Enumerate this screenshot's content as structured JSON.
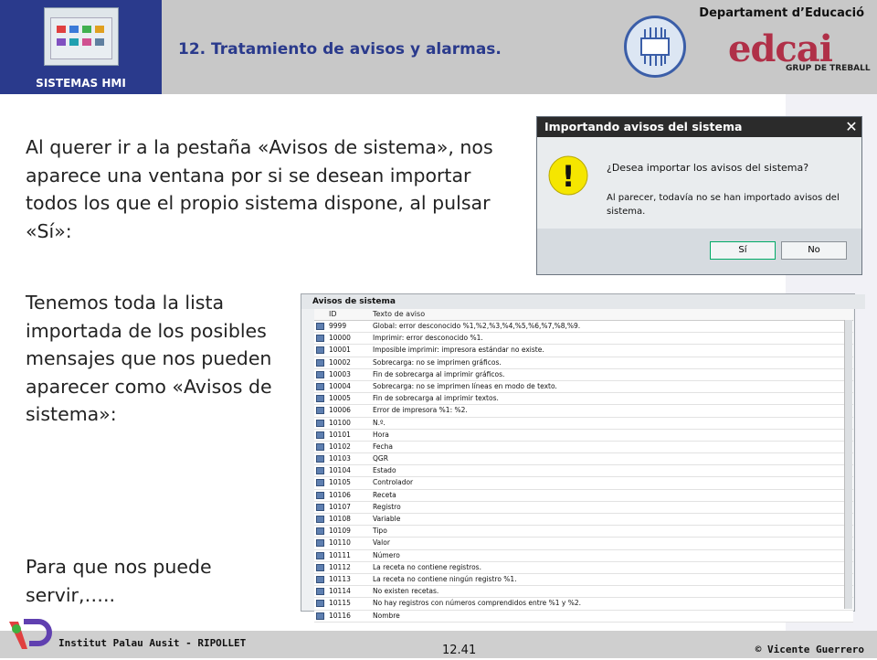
{
  "header": {
    "logo_label": "SISTEMAS HMI",
    "title": "12. Tratamiento de avisos y alarmas.",
    "department": "Departament d’Educació",
    "brand": "edcai",
    "brand_sub": "GRUP DE TREBALL",
    "colors": {
      "band": "#2a3a8c",
      "brand": "#b03048"
    }
  },
  "content": {
    "paragraph1": "Al querer ir a la pestaña «Avisos de sistema», nos aparece una ventana por si se desean importar todos los que el propio sistema dispone, al pulsar «Sí»:",
    "paragraph2": "Tenemos toda la lista importada de los posibles mensajes que nos pueden aparecer como «Avisos de sistema»:",
    "paragraph3": "Para que nos puede servir,….."
  },
  "dialog": {
    "title": "Importando avisos del sistema",
    "close_icon": "close-icon",
    "warning_icon": "warning-icon",
    "warning_glyph": "!",
    "question": "¿Desea importar los avisos del sistema?",
    "message": "Al parecer, todavía no se han importado avisos del sistema.",
    "yes_label": "Sí",
    "no_label": "No"
  },
  "table": {
    "title": "Avisos de sistema",
    "columns": [
      "ID",
      "Texto de aviso"
    ],
    "rows": [
      {
        "id": "9999",
        "text": "Global: error desconocido %1,%2,%3,%4,%5,%6,%7,%8,%9."
      },
      {
        "id": "10000",
        "text": "Imprimir: error desconocido %1."
      },
      {
        "id": "10001",
        "text": "Imposible imprimir: impresora estándar no existe."
      },
      {
        "id": "10002",
        "text": "Sobrecarga: no se imprimen gráficos."
      },
      {
        "id": "10003",
        "text": "Fin de sobrecarga al imprimir gráficos."
      },
      {
        "id": "10004",
        "text": "Sobrecarga: no se imprimen líneas en modo de texto."
      },
      {
        "id": "10005",
        "text": "Fin de sobrecarga al imprimir textos."
      },
      {
        "id": "10006",
        "text": "Error de impresora %1: %2."
      },
      {
        "id": "10100",
        "text": "N.º."
      },
      {
        "id": "10101",
        "text": "Hora"
      },
      {
        "id": "10102",
        "text": "Fecha"
      },
      {
        "id": "10103",
        "text": "QGR"
      },
      {
        "id": "10104",
        "text": "Estado"
      },
      {
        "id": "10105",
        "text": "Controlador"
      },
      {
        "id": "10106",
        "text": "Receta"
      },
      {
        "id": "10107",
        "text": "Registro"
      },
      {
        "id": "10108",
        "text": "Variable"
      },
      {
        "id": "10109",
        "text": "Tipo"
      },
      {
        "id": "10110",
        "text": "Valor"
      },
      {
        "id": "10111",
        "text": "Número"
      },
      {
        "id": "10112",
        "text": "La receta no contiene registros."
      },
      {
        "id": "10113",
        "text": "La receta no contiene ningún registro %1."
      },
      {
        "id": "10114",
        "text": "No existen recetas."
      },
      {
        "id": "10115",
        "text": "No hay registros con números comprendidos entre %1 y %2."
      },
      {
        "id": "10116",
        "text": "Nombre"
      }
    ]
  },
  "footer": {
    "institute": "Institut Palau Ausit - RIPOLLET",
    "page": "12.41",
    "author": "© Vicente Guerrero"
  }
}
